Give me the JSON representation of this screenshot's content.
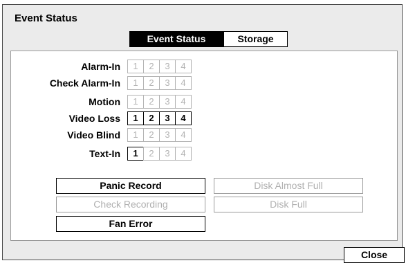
{
  "dialog": {
    "title": "Event Status"
  },
  "tabs": [
    {
      "label": "Event Status",
      "active": true
    },
    {
      "label": "Storage",
      "active": false
    }
  ],
  "rows": [
    {
      "label": "Alarm-In",
      "channels": [
        "1",
        "2",
        "3",
        "4"
      ],
      "active": [
        false,
        false,
        false,
        false
      ]
    },
    {
      "label": "Check Alarm-In",
      "channels": [
        "1",
        "2",
        "3",
        "4"
      ],
      "active": [
        false,
        false,
        false,
        false
      ]
    },
    {
      "label": "Motion",
      "channels": [
        "1",
        "2",
        "3",
        "4"
      ],
      "active": [
        false,
        false,
        false,
        false
      ]
    },
    {
      "label": "Video Loss",
      "channels": [
        "1",
        "2",
        "3",
        "4"
      ],
      "active": [
        true,
        true,
        true,
        true
      ]
    },
    {
      "label": "Video Blind",
      "channels": [
        "1",
        "2",
        "3",
        "4"
      ],
      "active": [
        false,
        false,
        false,
        false
      ]
    },
    {
      "label": "Text-In",
      "channels": [
        "1",
        "2",
        "3",
        "4"
      ],
      "active": [
        true,
        false,
        false,
        false
      ]
    }
  ],
  "events": [
    {
      "label": "Panic Record",
      "active": true
    },
    {
      "label": "Disk Almost Full",
      "active": false
    },
    {
      "label": "Check Recording",
      "active": false
    },
    {
      "label": "Disk Full",
      "active": false
    },
    {
      "label": "Fan Error",
      "active": true
    }
  ],
  "close_label": "Close"
}
